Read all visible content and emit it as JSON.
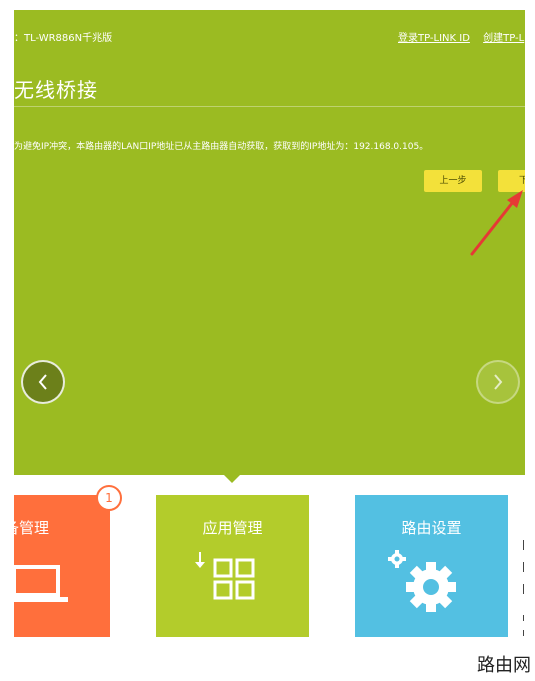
{
  "header": {
    "model": "：TL-WR886N千兆版",
    "links": [
      "登录TP-LINK ID",
      "创建TP-L"
    ]
  },
  "page": {
    "title": "无线桥接",
    "note": "为避免IP冲突，本路由器的LAN口IP地址已从主路由器自动获取，获取到的IP地址为：192.168.0.105。"
  },
  "buttons": {
    "prev": "上一步",
    "next": "下一"
  },
  "tiles": [
    {
      "title": "备管理",
      "badge": "1",
      "color": "#ff6f3c"
    },
    {
      "title": "应用管理",
      "color": "#b3cc2b"
    },
    {
      "title": "路由设置",
      "color": "#53c0e2"
    }
  ],
  "colors": {
    "hero_bg": "#9bbb22",
    "button_bg": "#f3e13a",
    "arrow": "#e53935"
  },
  "watermark": "路由网"
}
